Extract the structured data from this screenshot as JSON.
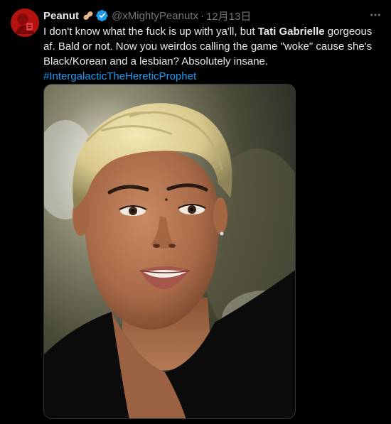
{
  "tweet": {
    "author": {
      "display_name": "Peanut",
      "handle": "@xMightyPeanutx",
      "badge_icon": "peanut-icon",
      "verified_icon": "verified-badge-icon",
      "avatar_color": "#c81414"
    },
    "separator": "·",
    "date": "12月13日",
    "more_icon": "more-horizontal-icon",
    "text": {
      "part1": "I don't know what the fuck is up with ya'll, but ",
      "bold_name": "Tati Gabrielle",
      "part2": " gorgeous af. Bald or not. Now you weirdos calling the game \"woke\" cause she's Black/Korean and a lesbian? Absolutely insane.",
      "hashtag": "#IntergalacticTheHereticProphet"
    },
    "media": {
      "type": "photo",
      "description_icon": "portrait-photo"
    },
    "colors": {
      "background": "#000000",
      "text": "#e7e9ea",
      "muted": "#71767b",
      "link": "#1d9bf0",
      "verified": "#1d9bf0"
    }
  }
}
